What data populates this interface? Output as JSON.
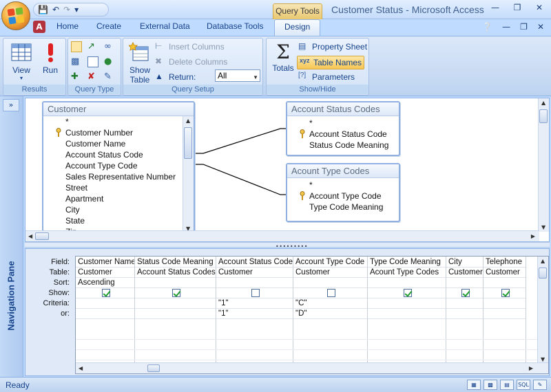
{
  "window": {
    "app_title": "Customer Status - Microsoft Access",
    "context_tab_title": "Query Tools"
  },
  "ribbon_tabs": [
    "Home",
    "Create",
    "External Data",
    "Database Tools",
    "Design"
  ],
  "ribbon": {
    "results": {
      "label": "Results",
      "view": "View",
      "run": "Run"
    },
    "query_type": {
      "label": "Query Type"
    },
    "query_setup": {
      "label": "Query Setup",
      "show_table_line1": "Show",
      "show_table_line2": "Table",
      "insert_columns": "Insert Columns",
      "delete_columns": "Delete Columns",
      "return_label": "Return:",
      "return_value": "All"
    },
    "show_hide": {
      "label": "Show/Hide",
      "totals": "Totals",
      "property_sheet": "Property Sheet",
      "table_names": "Table Names",
      "parameters": "Parameters"
    }
  },
  "navigation_pane": {
    "label": "Navigation Pane",
    "toggle": "»"
  },
  "tables": [
    {
      "title": "Customer",
      "fields": [
        "*",
        "Customer Number",
        "Customer Name",
        "Account Status Code",
        "Account Type Code",
        "Sales Representative Number",
        "Street",
        "Apartment",
        "City",
        "State",
        "Zip"
      ]
    },
    {
      "title": "Account Status Codes",
      "fields": [
        "*",
        "Account Status Code",
        "Status Code Meaning"
      ]
    },
    {
      "title": "Acount Type Codes",
      "fields": [
        "*",
        "Account Type Code",
        "Type Code Meaning"
      ]
    }
  ],
  "grid": {
    "row_labels": [
      "Field:",
      "Table:",
      "Sort:",
      "Show:",
      "Criteria:",
      "or:"
    ],
    "columns": [
      {
        "field": "Customer Name",
        "table": "Customer",
        "sort": "Ascending",
        "show": true,
        "criteria": "",
        "or": ""
      },
      {
        "field": "Status Code Meaning",
        "table": "Account Status Codes",
        "sort": "",
        "show": true,
        "criteria": "",
        "or": ""
      },
      {
        "field": "Account Status Code",
        "table": "Customer",
        "sort": "",
        "show": false,
        "criteria": "\"1\"",
        "or": "\"1\""
      },
      {
        "field": "Account Type Code",
        "table": "Customer",
        "sort": "",
        "show": false,
        "criteria": "\"C\"",
        "or": "\"D\""
      },
      {
        "field": "Type Code Meaning",
        "table": "Acount Type Codes",
        "sort": "",
        "show": true,
        "criteria": "",
        "or": ""
      },
      {
        "field": "City",
        "table": "Customer",
        "sort": "",
        "show": true,
        "criteria": "",
        "or": ""
      },
      {
        "field": "Telephone",
        "table": "Customer",
        "sort": "",
        "show": true,
        "criteria": "",
        "or": ""
      }
    ]
  },
  "status": {
    "text": "Ready",
    "sql_label": "SQL"
  }
}
